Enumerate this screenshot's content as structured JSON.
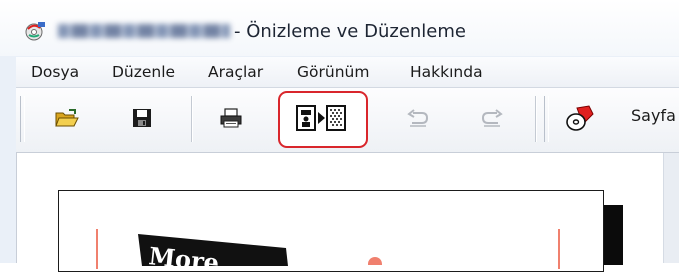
{
  "window": {
    "title_blurred": "Swap.py's HowApp",
    "title_suffix": "- Önizleme ve Düzenleme",
    "app_icon": "printer-disc-app-icon"
  },
  "menu": {
    "items": [
      {
        "label": "Dosya"
      },
      {
        "label": "Düzenle"
      },
      {
        "label": "Araçlar"
      },
      {
        "label": "Görünüm"
      },
      {
        "label": "Hakkında"
      }
    ]
  },
  "toolbar": {
    "buttons": [
      {
        "icon": "open-folder-icon"
      },
      {
        "icon": "save-icon"
      },
      {
        "icon": "print-icon"
      },
      {
        "icon": "page-layout-toggle-icon",
        "highlighted": true
      },
      {
        "icon": "undo-icon",
        "enabled": false
      },
      {
        "icon": "redo-icon",
        "enabled": false
      },
      {
        "icon": "disc-label-icon"
      }
    ],
    "trailing_label": "Sayfa"
  },
  "preview": {
    "artwork_text": "More"
  },
  "colors": {
    "highlight": "#d9262c",
    "accent_red": "#e02020",
    "margin_guide": "#f0806e"
  }
}
